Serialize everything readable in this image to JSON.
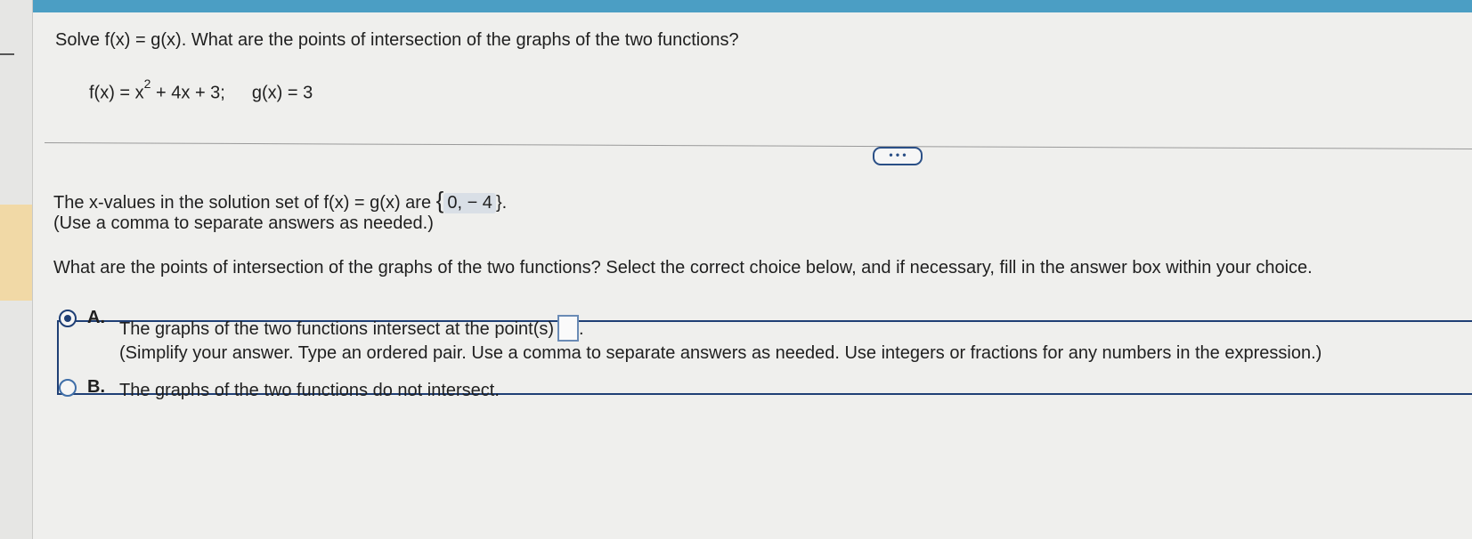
{
  "question": {
    "prompt": "Solve f(x) = g(x). What are the points of intersection of the graphs of the two functions?",
    "f_prefix": "f(x) = x",
    "f_exponent": "2",
    "f_suffix": " + 4x + 3;",
    "g_def": "g(x) = 3"
  },
  "more_button": {
    "label": "• • •"
  },
  "part1": {
    "text_before": "The x-values in the solution set of f(x) = g(x) are",
    "answer_open": "{",
    "answer": "0, − 4",
    "answer_close": "}.",
    "hint": "(Use a comma to separate answers as needed.)"
  },
  "part2": {
    "prompt": "What are the points of intersection of the graphs of the two functions? Select the correct choice below, and if necessary, fill in the answer box within your choice."
  },
  "choices": [
    {
      "letter": "A.",
      "text": "The graphs of the two functions intersect at the point(s)",
      "trailing": ".",
      "hint": "(Simplify your answer. Type an ordered pair. Use a comma to separate answers as needed. Use integers or fractions for any numbers in the expression.)",
      "selected": true
    },
    {
      "letter": "B.",
      "text": "The graphs of the two functions do not intersect.",
      "selected": false
    }
  ],
  "colors": {
    "accent": "#1f3f75",
    "topbar": "#4b9ec4"
  }
}
